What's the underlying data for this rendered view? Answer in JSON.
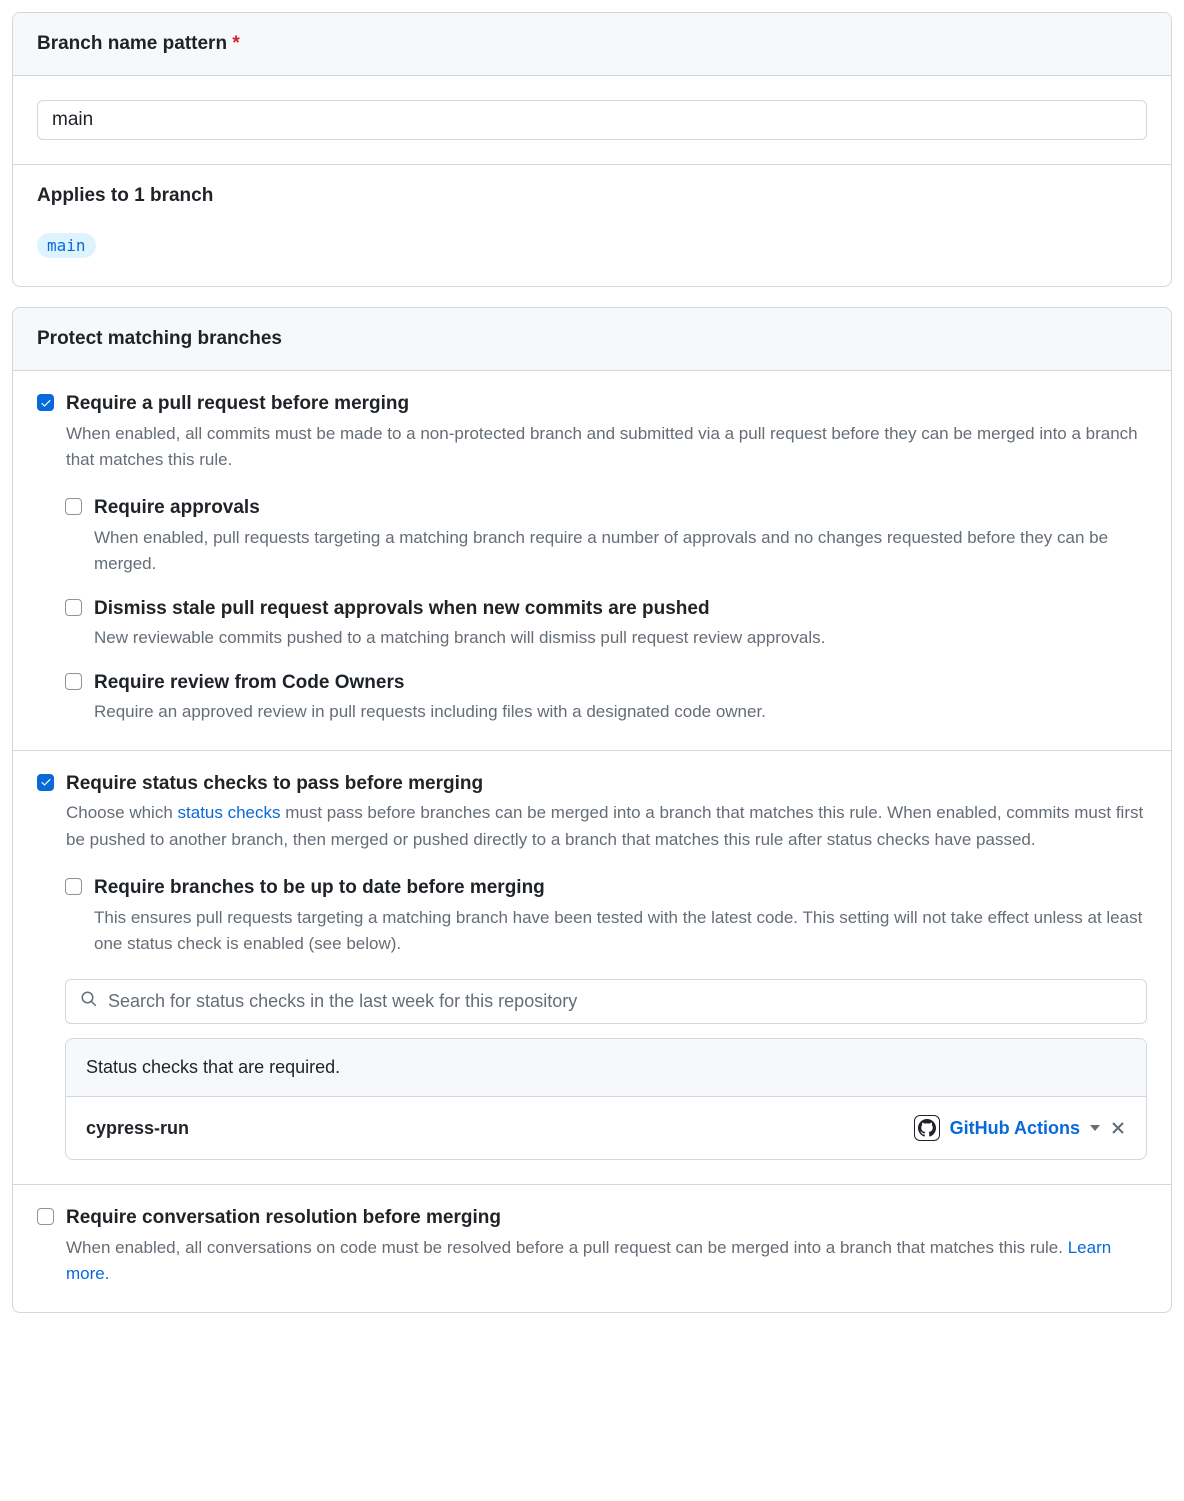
{
  "pattern": {
    "header": "Branch name pattern",
    "value": "main"
  },
  "applies": {
    "title": "Applies to 1 branch",
    "branch": "main"
  },
  "protect": {
    "header": "Protect matching branches",
    "rules": {
      "pr": {
        "title": "Require a pull request before merging",
        "desc": "When enabled, all commits must be made to a non-protected branch and submitted via a pull request before they can be merged into a branch that matches this rule.",
        "sub": {
          "approvals": {
            "title": "Require approvals",
            "desc": "When enabled, pull requests targeting a matching branch require a number of approvals and no changes requested before they can be merged."
          },
          "dismiss": {
            "title": "Dismiss stale pull request approvals when new commits are pushed",
            "desc": "New reviewable commits pushed to a matching branch will dismiss pull request review approvals."
          },
          "codeowners": {
            "title": "Require review from Code Owners",
            "desc": "Require an approved review in pull requests including files with a designated code owner."
          }
        }
      },
      "status": {
        "title": "Require status checks to pass before merging",
        "desc_pre": "Choose which ",
        "desc_link": "status checks",
        "desc_post": " must pass before branches can be merged into a branch that matches this rule. When enabled, commits must first be pushed to another branch, then merged or pushed directly to a branch that matches this rule after status checks have passed.",
        "sub": {
          "uptodate": {
            "title": "Require branches to be up to date before merging",
            "desc": "This ensures pull requests targeting a matching branch have been tested with the latest code. This setting will not take effect unless at least one status check is enabled (see below)."
          }
        },
        "search_placeholder": "Search for status checks in the last week for this repository",
        "required_head": "Status checks that are required.",
        "check": {
          "name": "cypress-run",
          "source": "GitHub Actions"
        }
      },
      "conversation": {
        "title": "Require conversation resolution before merging",
        "desc_pre": "When enabled, all conversations on code must be resolved before a pull request can be merged into a branch that matches this rule. ",
        "learn_more": "Learn more."
      }
    }
  }
}
